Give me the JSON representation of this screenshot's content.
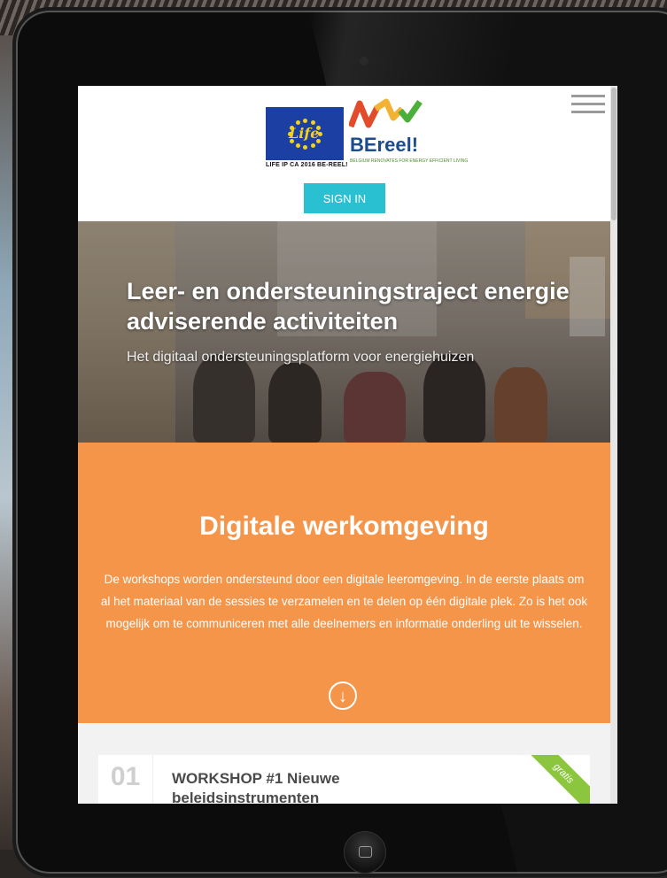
{
  "header": {
    "eu_caption": "LIFE IP CA 2016 BE-REEL!",
    "eu_logo_word": "Life",
    "brand_name": "BEreel!",
    "brand_tagline": "BELGIUM RENOVATES FOR ENERGY EFFICIENT LIVING",
    "signin_label": "SIGN IN",
    "menu_icon": "hamburger-menu-icon"
  },
  "hero": {
    "title": "Leer- en ondersteuningstraject energie adviserende activiteiten",
    "subtitle": "Het digitaal ondersteuningsplatform voor energiehuizen"
  },
  "section": {
    "title": "Digitale werkomgeving",
    "body": "De workshops worden ondersteund door een digitale leeromgeving. In de eerste plaats om  al het materiaal van de sessies te verzamelen en te delen op één digitale plek. Zo is het ook mogelijk om te communiceren met alle deelnemers en informatie onderling uit te wisselen.",
    "scroll_icon": "arrow-down-circle-icon",
    "scroll_glyph": "↓"
  },
  "workshops": [
    {
      "number": "01",
      "title": "WORKSHOP #1 Nieuwe beleidsinstrumenten",
      "badge": "gratis"
    }
  ],
  "colors": {
    "accent_teal": "#29c1d1",
    "orange": "#f5954a",
    "ribbon_green": "#8cc63f",
    "eu_blue": "#1b3fa3"
  }
}
